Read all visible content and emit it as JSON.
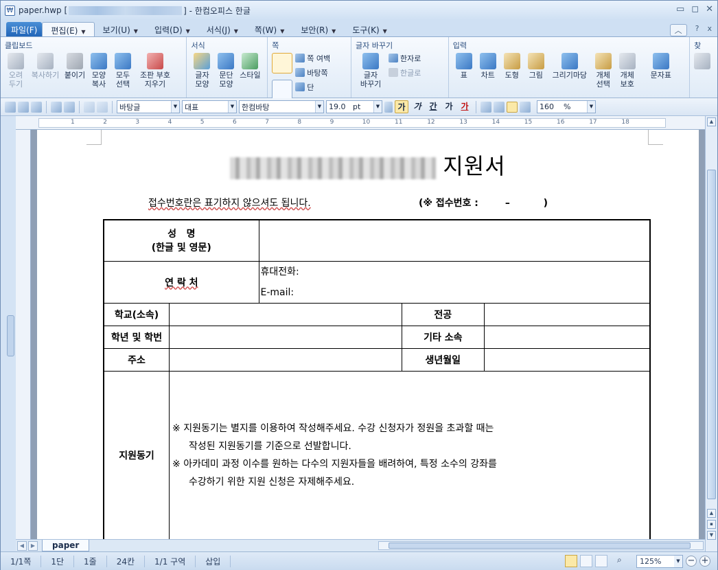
{
  "window": {
    "title_prefix": "paper.hwp [",
    "title_suffix": "] - 한컴오피스 한글",
    "buttons": [
      "▭",
      "◻",
      "✕"
    ]
  },
  "menu": {
    "file": "파일(F)",
    "items": [
      "편집(E)",
      "보기(U)",
      "입력(D)",
      "서식(J)",
      "쪽(W)",
      "보안(R)",
      "도구(K)"
    ],
    "right": [
      "?",
      "x"
    ]
  },
  "ribbon": {
    "clipboard": {
      "title": "클립보드",
      "buttons": [
        "오려\n두기",
        "복사하기",
        "붙이기",
        "모양\n복사",
        "모두\n선택",
        "조판 부호\n지우기"
      ]
    },
    "format": {
      "title": "서식",
      "buttons": [
        "글자\n모양",
        "문단\n모양",
        "스타일"
      ]
    },
    "page": {
      "title": "쪽",
      "small": [
        "쪽 여백",
        "바탕쪽",
        "단"
      ]
    },
    "convert": {
      "title": "글자 바꾸기",
      "big": "글자\n바꾸기",
      "small": [
        "한자로",
        "한글로"
      ]
    },
    "insert": {
      "title": "입력",
      "buttons": [
        "표",
        "차트",
        "도형",
        "그림",
        "그리기마당",
        "개체\n선택",
        "개체\n보호",
        "문자표"
      ]
    },
    "extra": {
      "title": "찾"
    }
  },
  "toolbar": {
    "style": "바탕글",
    "lang": "대표",
    "font": "한컴바탕",
    "size": "19.0",
    "size_unit": "pt",
    "bold": "가",
    "italic": "가",
    "underline": "간",
    "strike": "가",
    "color": "가",
    "line_spacing": "160",
    "line_unit": "%"
  },
  "ruler": {
    "numbers": [
      "1",
      "2",
      "3",
      "4",
      "5",
      "6",
      "7",
      "8",
      "9",
      "10",
      "11",
      "12",
      "13",
      "14",
      "15",
      "16",
      "17",
      "18"
    ]
  },
  "document": {
    "title": "지원서",
    "notice": "접수번호란은 표기하지 않으셔도 됩니다.",
    "receipt": "(※ 접수번호 :        –          )",
    "form": {
      "name_label_1": "성   명",
      "name_label_2": "(한글 및 영문)",
      "contact_label": "연 락 처",
      "phone": "휴대전화:",
      "email": "E-mail:",
      "school": "학교(소속)",
      "major": "전공",
      "grade": "학년 및 학번",
      "other": "기타 소속",
      "address": "주소",
      "birthday": "생년월일",
      "motive_label": "지원동기",
      "motive_lines": [
        "※ 지원동기는 별지를 이용하여 작성해주세요. 수강 신청자가 정원을 초과할 때는",
        "작성된 지원동기를 기준으로 선발합니다.",
        "※ 아카데미 과정 이수를 원하는 다수의 지원자들을 배려하여, 특정 소수의 강좌를",
        "수강하기 위한 지원 신청은 자제해주세요."
      ]
    }
  },
  "sheet_tab": "paper",
  "status": {
    "page": "1/1쪽",
    "column": "1단",
    "line": "1줄",
    "col": "24칸",
    "section": "1/1 구역",
    "mode": "삽입",
    "zoom": "125%"
  },
  "colors": {
    "accent": "#1f63b7",
    "frame": "#d4e3f4"
  }
}
